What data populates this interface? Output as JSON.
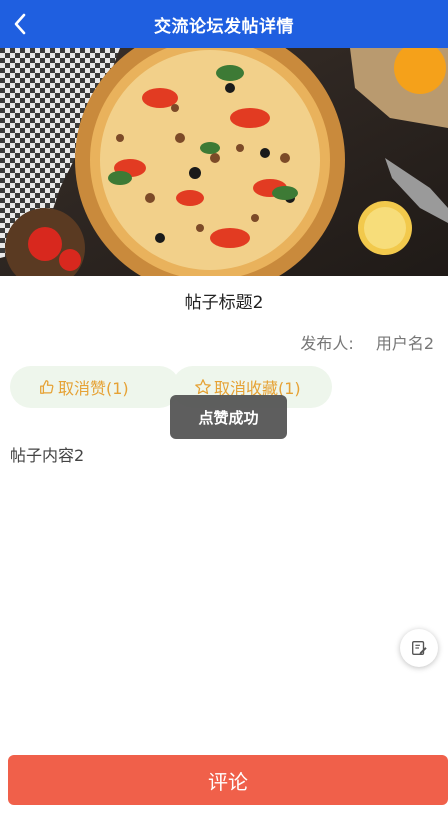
{
  "header": {
    "title": "交流论坛发帖详情",
    "color": "#1f5fe0"
  },
  "post": {
    "title": "帖子标题2",
    "author_label": "发布人:",
    "author_name": "用户名2",
    "content": "帖子内容2"
  },
  "actions": {
    "like_label": "取消赞(1)",
    "favorite_label": "取消收藏(1)",
    "text_color": "#e6a235"
  },
  "toast": {
    "message": "点赞成功"
  },
  "footer": {
    "comment_label": "评论",
    "color": "#f0604a"
  }
}
